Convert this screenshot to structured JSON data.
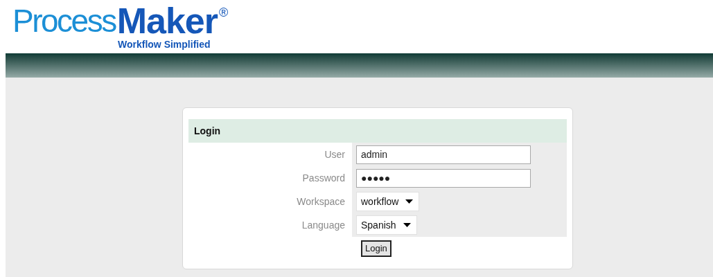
{
  "logo": {
    "light": "Process",
    "bold": "Maker",
    "mark": "®",
    "tagline": "Workflow Simplified"
  },
  "login": {
    "title": "Login",
    "fields": [
      {
        "kind": "text",
        "label": "User",
        "value": "admin"
      },
      {
        "kind": "text",
        "label": "Password",
        "value": "●●●●●"
      },
      {
        "kind": "select",
        "label": "Workspace",
        "value": "workflow"
      },
      {
        "kind": "select",
        "label": "Language",
        "value": "Spanish"
      }
    ],
    "button": "Login"
  }
}
